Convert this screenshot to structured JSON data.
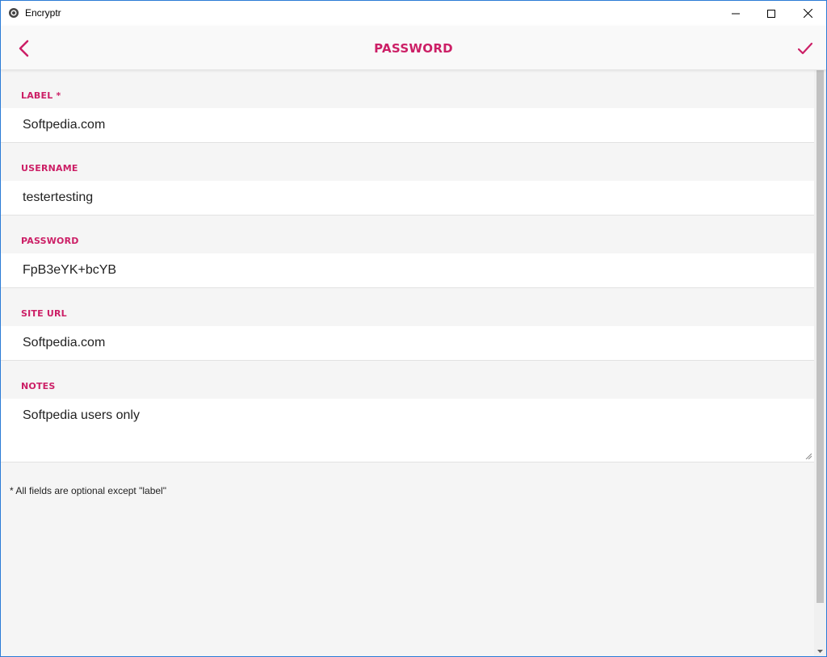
{
  "window": {
    "title": "Encryptr",
    "minimize_icon": "minimize-icon",
    "maximize_icon": "maximize-icon",
    "close_icon": "close-icon"
  },
  "header": {
    "title": "PASSWORD",
    "back_icon": "chevron-left-icon",
    "save_icon": "checkmark-icon",
    "accent": "#cc1f66"
  },
  "fields": {
    "label": {
      "label": "LABEL *",
      "value": "Softpedia.com"
    },
    "username": {
      "label": "USERNAME",
      "value": "testertesting"
    },
    "password": {
      "label": "PASSWORD",
      "value": "FpB3eYK+bcYB"
    },
    "site_url": {
      "label": "SITE URL",
      "value": "Softpedia.com"
    },
    "notes": {
      "label": "NOTES",
      "value": "Softpedia users only"
    }
  },
  "footnote": "* All fields are optional except \"label\""
}
